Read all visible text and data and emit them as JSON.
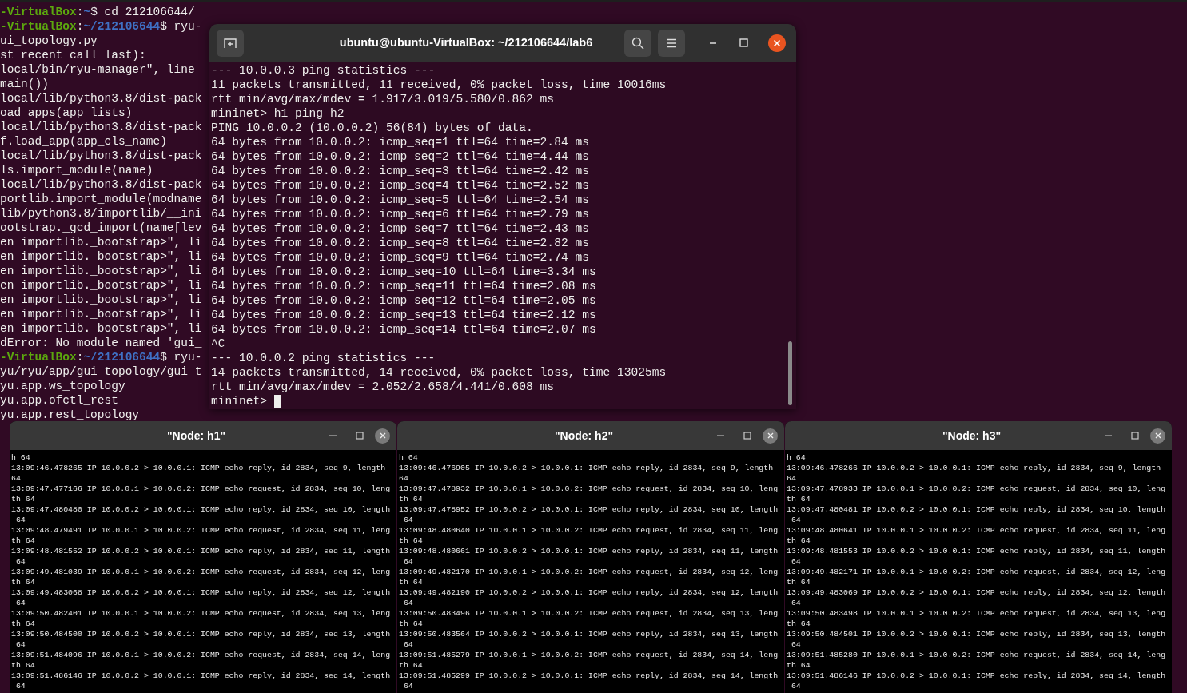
{
  "background_terminal": {
    "lines": [
      {
        "segments": [
          {
            "kind": "host",
            "text": "-VirtualBox"
          },
          {
            "kind": "plain",
            "text": ":"
          },
          {
            "kind": "path",
            "text": "~"
          },
          {
            "kind": "plain",
            "text": "$ cd 212106644/"
          }
        ]
      },
      {
        "segments": [
          {
            "kind": "host",
            "text": "-VirtualBox"
          },
          {
            "kind": "plain",
            "text": ":"
          },
          {
            "kind": "path",
            "text": "~/212106644"
          },
          {
            "kind": "plain",
            "text": "$ ryu-"
          }
        ]
      },
      {
        "segments": [
          {
            "kind": "plain",
            "text": "ui_topology.py"
          }
        ]
      },
      {
        "segments": [
          {
            "kind": "plain",
            "text": "st recent call last):"
          }
        ]
      },
      {
        "segments": [
          {
            "kind": "plain",
            "text": "local/bin/ryu-manager\", line"
          }
        ]
      },
      {
        "segments": [
          {
            "kind": "plain",
            "text": "main())"
          }
        ]
      },
      {
        "segments": [
          {
            "kind": "plain",
            "text": "local/lib/python3.8/dist-pack"
          }
        ]
      },
      {
        "segments": [
          {
            "kind": "plain",
            "text": "oad_apps(app_lists)"
          }
        ]
      },
      {
        "segments": [
          {
            "kind": "plain",
            "text": "local/lib/python3.8/dist-pack"
          }
        ]
      },
      {
        "segments": [
          {
            "kind": "plain",
            "text": "f.load_app(app_cls_name)"
          }
        ]
      },
      {
        "segments": [
          {
            "kind": "plain",
            "text": "local/lib/python3.8/dist-pack"
          }
        ]
      },
      {
        "segments": [
          {
            "kind": "plain",
            "text": "ls.import_module(name)"
          }
        ]
      },
      {
        "segments": [
          {
            "kind": "plain",
            "text": "local/lib/python3.8/dist-pack"
          }
        ]
      },
      {
        "segments": [
          {
            "kind": "plain",
            "text": "portlib.import_module(modname"
          }
        ]
      },
      {
        "segments": [
          {
            "kind": "plain",
            "text": "lib/python3.8/importlib/__ini"
          }
        ]
      },
      {
        "segments": [
          {
            "kind": "plain",
            "text": "ootstrap._gcd_import(name[lev"
          }
        ]
      },
      {
        "segments": [
          {
            "kind": "plain",
            "text": "en importlib._bootstrap>\", li"
          }
        ]
      },
      {
        "segments": [
          {
            "kind": "plain",
            "text": "en importlib._bootstrap>\", li"
          }
        ]
      },
      {
        "segments": [
          {
            "kind": "plain",
            "text": "en importlib._bootstrap>\", li"
          }
        ]
      },
      {
        "segments": [
          {
            "kind": "plain",
            "text": "en importlib._bootstrap>\", li"
          }
        ]
      },
      {
        "segments": [
          {
            "kind": "plain",
            "text": "en importlib._bootstrap>\", li"
          }
        ]
      },
      {
        "segments": [
          {
            "kind": "plain",
            "text": "en importlib._bootstrap>\", li"
          }
        ]
      },
      {
        "segments": [
          {
            "kind": "plain",
            "text": "en importlib._bootstrap>\", li"
          }
        ]
      },
      {
        "segments": [
          {
            "kind": "plain",
            "text": "dError: No module named 'gui_"
          }
        ]
      },
      {
        "segments": [
          {
            "kind": "host",
            "text": "-VirtualBox"
          },
          {
            "kind": "plain",
            "text": ":"
          },
          {
            "kind": "path",
            "text": "~/212106644"
          },
          {
            "kind": "plain",
            "text": "$ ryu-"
          }
        ]
      },
      {
        "segments": [
          {
            "kind": "plain",
            "text": "yu/ryu/app/gui_topology/gui_t"
          }
        ]
      },
      {
        "segments": [
          {
            "kind": "plain",
            "text": "yu.app.ws_topology"
          }
        ]
      },
      {
        "segments": [
          {
            "kind": "plain",
            "text": "yu.app.ofctl_rest"
          }
        ]
      },
      {
        "segments": [
          {
            "kind": "plain",
            "text": "yu.app.rest_topology"
          }
        ]
      }
    ]
  },
  "main_terminal": {
    "title": "ubuntu@ubuntu-VirtualBox: ~/212106644/lab6",
    "lines": [
      "--- 10.0.0.3 ping statistics ---",
      "11 packets transmitted, 11 received, 0% packet loss, time 10016ms",
      "rtt min/avg/max/mdev = 1.917/3.019/5.580/0.862 ms",
      "mininet> h1 ping h2",
      "PING 10.0.0.2 (10.0.0.2) 56(84) bytes of data.",
      "64 bytes from 10.0.0.2: icmp_seq=1 ttl=64 time=2.84 ms",
      "64 bytes from 10.0.0.2: icmp_seq=2 ttl=64 time=4.44 ms",
      "64 bytes from 10.0.0.2: icmp_seq=3 ttl=64 time=2.42 ms",
      "64 bytes from 10.0.0.2: icmp_seq=4 ttl=64 time=2.52 ms",
      "64 bytes from 10.0.0.2: icmp_seq=5 ttl=64 time=2.54 ms",
      "64 bytes from 10.0.0.2: icmp_seq=6 ttl=64 time=2.79 ms",
      "64 bytes from 10.0.0.2: icmp_seq=7 ttl=64 time=2.43 ms",
      "64 bytes from 10.0.0.2: icmp_seq=8 ttl=64 time=2.82 ms",
      "64 bytes from 10.0.0.2: icmp_seq=9 ttl=64 time=2.74 ms",
      "64 bytes from 10.0.0.2: icmp_seq=10 ttl=64 time=3.34 ms",
      "64 bytes from 10.0.0.2: icmp_seq=11 ttl=64 time=2.08 ms",
      "64 bytes from 10.0.0.2: icmp_seq=12 ttl=64 time=2.05 ms",
      "64 bytes from 10.0.0.2: icmp_seq=13 ttl=64 time=2.12 ms",
      "64 bytes from 10.0.0.2: icmp_seq=14 ttl=64 time=2.07 ms",
      "^C",
      "--- 10.0.0.2 ping statistics ---",
      "14 packets transmitted, 14 received, 0% packet loss, time 13025ms",
      "rtt min/avg/max/mdev = 2.052/2.658/4.441/0.608 ms",
      "mininet> "
    ]
  },
  "node_windows": [
    {
      "title": "\"Node: h1\"",
      "lines": [
        "h 64",
        "13:09:46.478265 IP 10.0.0.2 > 10.0.0.1: ICMP echo reply, id 2834, seq 9, length",
        "64",
        "13:09:47.477166 IP 10.0.0.1 > 10.0.0.2: ICMP echo request, id 2834, seq 10, leng",
        "th 64",
        "13:09:47.480480 IP 10.0.0.2 > 10.0.0.1: ICMP echo reply, id 2834, seq 10, length",
        " 64",
        "13:09:48.479491 IP 10.0.0.1 > 10.0.0.2: ICMP echo request, id 2834, seq 11, leng",
        "th 64",
        "13:09:48.481552 IP 10.0.0.2 > 10.0.0.1: ICMP echo reply, id 2834, seq 11, length",
        " 64",
        "13:09:49.481039 IP 10.0.0.1 > 10.0.0.2: ICMP echo request, id 2834, seq 12, leng",
        "th 64",
        "13:09:49.483068 IP 10.0.0.2 > 10.0.0.1: ICMP echo reply, id 2834, seq 12, length",
        " 64",
        "13:09:50.482401 IP 10.0.0.1 > 10.0.0.2: ICMP echo request, id 2834, seq 13, leng",
        "th 64",
        "13:09:50.484500 IP 10.0.0.2 > 10.0.0.1: ICMP echo reply, id 2834, seq 13, length",
        " 64",
        "13:09:51.484096 IP 10.0.0.1 > 10.0.0.2: ICMP echo request, id 2834, seq 14, leng",
        "th 64",
        "13:09:51.486146 IP 10.0.0.2 > 10.0.0.1: ICMP echo reply, id 2834, seq 14, length",
        " 64"
      ]
    },
    {
      "title": "\"Node: h2\"",
      "lines": [
        "h 64",
        "13:09:46.476905 IP 10.0.0.2 > 10.0.0.1: ICMP echo reply, id 2834, seq 9, length",
        "64",
        "13:09:47.478932 IP 10.0.0.1 > 10.0.0.2: ICMP echo request, id 2834, seq 10, leng",
        "th 64",
        "13:09:47.478952 IP 10.0.0.2 > 10.0.0.1: ICMP echo reply, id 2834, seq 10, length",
        " 64",
        "13:09:48.480640 IP 10.0.0.1 > 10.0.0.2: ICMP echo request, id 2834, seq 11, leng",
        "th 64",
        "13:09:48.480661 IP 10.0.0.2 > 10.0.0.1: ICMP echo reply, id 2834, seq 11, length",
        " 64",
        "13:09:49.482170 IP 10.0.0.1 > 10.0.0.2: ICMP echo request, id 2834, seq 12, leng",
        "th 64",
        "13:09:49.482190 IP 10.0.0.2 > 10.0.0.1: ICMP echo reply, id 2834, seq 12, length",
        " 64",
        "13:09:50.483496 IP 10.0.0.1 > 10.0.0.2: ICMP echo request, id 2834, seq 13, leng",
        "th 64",
        "13:09:50.483564 IP 10.0.0.2 > 10.0.0.1: ICMP echo reply, id 2834, seq 13, length",
        " 64",
        "13:09:51.485279 IP 10.0.0.1 > 10.0.0.2: ICMP echo request, id 2834, seq 14, leng",
        "th 64",
        "13:09:51.485299 IP 10.0.0.2 > 10.0.0.1: ICMP echo reply, id 2834, seq 14, length",
        " 64"
      ]
    },
    {
      "title": "\"Node: h3\"",
      "lines": [
        "h 64",
        "13:09:46.478266 IP 10.0.0.2 > 10.0.0.1: ICMP echo reply, id 2834, seq 9, length",
        "64",
        "13:09:47.478933 IP 10.0.0.1 > 10.0.0.2: ICMP echo request, id 2834, seq 10, leng",
        "th 64",
        "13:09:47.480481 IP 10.0.0.2 > 10.0.0.1: ICMP echo reply, id 2834, seq 10, length",
        " 64",
        "13:09:48.480641 IP 10.0.0.1 > 10.0.0.2: ICMP echo request, id 2834, seq 11, leng",
        "th 64",
        "13:09:48.481553 IP 10.0.0.2 > 10.0.0.1: ICMP echo reply, id 2834, seq 11, length",
        " 64",
        "13:09:49.482171 IP 10.0.0.1 > 10.0.0.2: ICMP echo request, id 2834, seq 12, leng",
        "th 64",
        "13:09:49.483069 IP 10.0.0.2 > 10.0.0.1: ICMP echo reply, id 2834, seq 12, length",
        " 64",
        "13:09:50.483498 IP 10.0.0.1 > 10.0.0.2: ICMP echo request, id 2834, seq 13, leng",
        "th 64",
        "13:09:50.484501 IP 10.0.0.2 > 10.0.0.1: ICMP echo reply, id 2834, seq 13, length",
        " 64",
        "13:09:51.485280 IP 10.0.0.1 > 10.0.0.2: ICMP echo request, id 2834, seq 14, leng",
        "th 64",
        "13:09:51.486146 IP 10.0.0.2 > 10.0.0.1: ICMP echo reply, id 2834, seq 14, length",
        " 64"
      ]
    }
  ]
}
